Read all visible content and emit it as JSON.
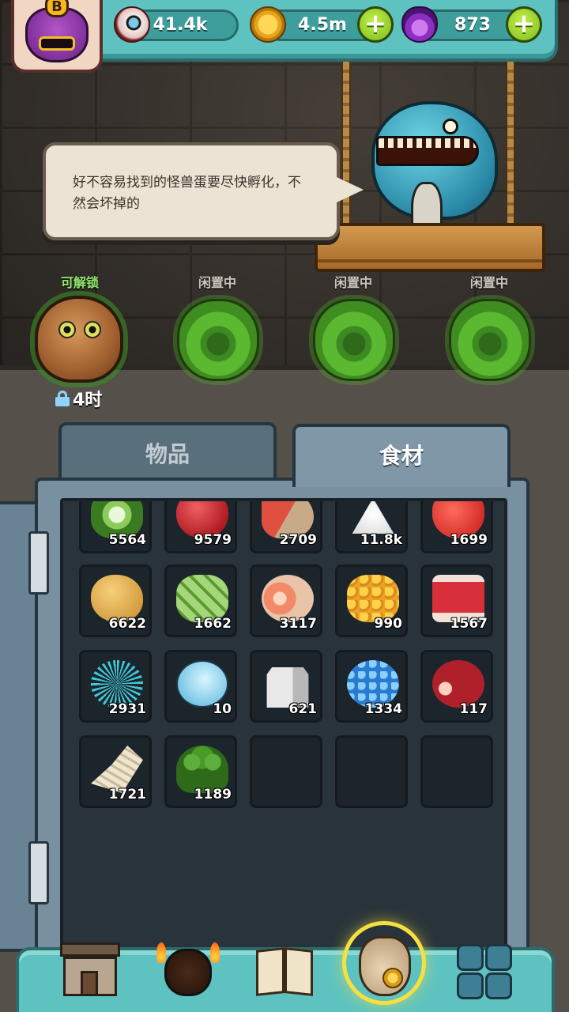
{
  "resources": {
    "eyes": "41.4k",
    "coins": "4.5m",
    "potions": "873",
    "add_symbol": "+"
  },
  "player": {
    "rank_badge": "B"
  },
  "speech": {
    "text": "好不容易找到的怪兽蛋要尽快孵化，不然会坏掉的"
  },
  "incubators": {
    "slots": [
      {
        "status": "可解锁",
        "timer": "4时"
      },
      {
        "status": "闲置中"
      },
      {
        "status": "闲置中"
      },
      {
        "status": "闲置中"
      }
    ]
  },
  "inventory": {
    "tabs": [
      {
        "label": "物品",
        "active": false
      },
      {
        "label": "食材",
        "active": true
      }
    ],
    "items": [
      {
        "icon": "cucumber-slice-icon",
        "count": "5564"
      },
      {
        "icon": "apple-icon",
        "count": "9579"
      },
      {
        "icon": "steak-slice-icon",
        "count": "2709"
      },
      {
        "icon": "salt-pile-icon",
        "count": "11.8k"
      },
      {
        "icon": "strawberry-icon",
        "count": "1699"
      },
      {
        "icon": "potato-icon",
        "count": "6622"
      },
      {
        "icon": "pickle-icon",
        "count": "1662"
      },
      {
        "icon": "ham-icon",
        "count": "3117"
      },
      {
        "icon": "honeycomb-icon",
        "count": "990"
      },
      {
        "icon": "raw-meat-icon",
        "count": "1567"
      },
      {
        "icon": "sea-urchin-icon",
        "count": "2931"
      },
      {
        "icon": "light-bulb-icon",
        "count": "10"
      },
      {
        "icon": "milk-carton-icon",
        "count": "621"
      },
      {
        "icon": "blueberry-cluster-icon",
        "count": "1334"
      },
      {
        "icon": "roast-meat-icon",
        "count": "117"
      },
      {
        "icon": "shell-root-icon",
        "count": "1721"
      },
      {
        "icon": "broccoli-icon",
        "count": "1189"
      }
    ]
  },
  "nav": [
    {
      "icon": "shop-building-icon"
    },
    {
      "icon": "monster-den-icon"
    },
    {
      "icon": "recipe-book-icon"
    },
    {
      "icon": "ingredient-bag-icon",
      "active": true
    },
    {
      "icon": "grid-menu-icon"
    }
  ]
}
